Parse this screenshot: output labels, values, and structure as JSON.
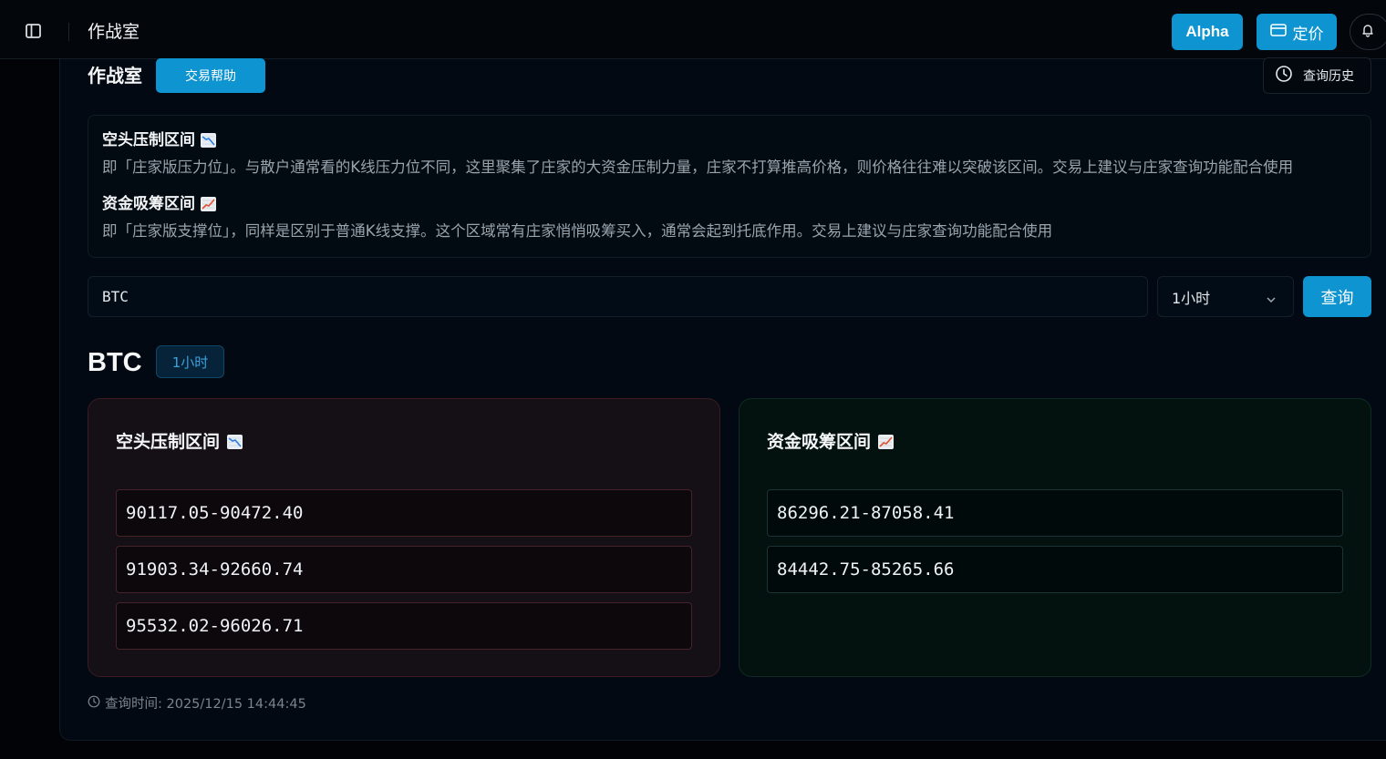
{
  "header": {
    "title": "作战室",
    "alpha_label": "Alpha",
    "pricing_label": "定价"
  },
  "page": {
    "title": "作战室",
    "help_label": "交易帮助",
    "history_label": "查询历史"
  },
  "info": {
    "resistance_heading": "空头压制区间",
    "resistance_text": "即「庄家版压力位」。与散户通常看的K线压力位不同，这里聚集了庄家的大资金压制力量，庄家不打算推高价格，则价格往往难以突破该区间。交易上建议与庄家查询功能配合使用",
    "support_heading": "资金吸筹区间",
    "support_text": "即「庄家版支撑位」，同样是区别于普通K线支撑。这个区域常有庄家悄悄吸筹买入，通常会起到托底作用。交易上建议与庄家查询功能配合使用"
  },
  "query_form": {
    "symbol_value": "BTC",
    "timeframe": "1小时",
    "submit_label": "查询"
  },
  "result": {
    "symbol": "BTC",
    "timeframe": "1小时",
    "resistance": {
      "title": "空头压制区间",
      "zones": [
        "90117.05-90472.40",
        "91903.34-92660.74",
        "95532.02-96026.71"
      ]
    },
    "support": {
      "title": "资金吸筹区间",
      "zones": [
        "86296.21-87058.41",
        "84442.75-85265.66"
      ]
    },
    "query_time": "查询时间: 2025/12/15 14:44:45"
  },
  "colors": {
    "accent": "#0d94d1",
    "resistance_border": "#48222a",
    "support_border": "#1b3334"
  },
  "icons": {
    "resistance": "chart-decreasing-icon",
    "support": "chart-increasing-icon"
  }
}
